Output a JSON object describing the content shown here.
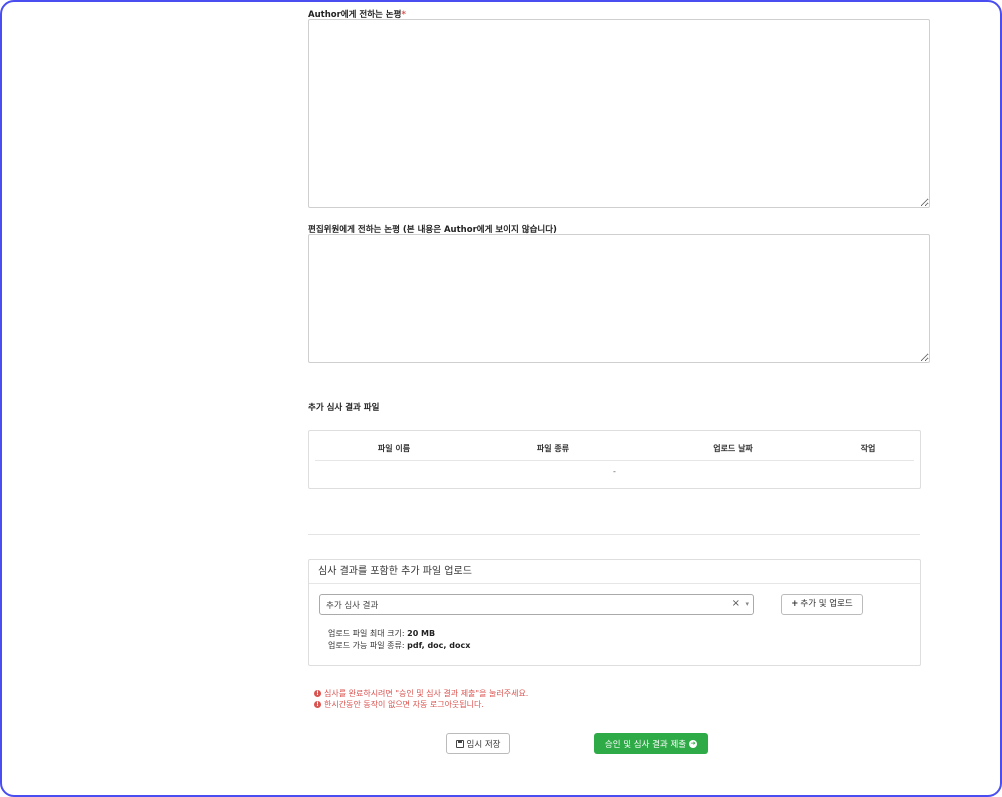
{
  "author_comment": {
    "label": "Author에게 전하는 논평",
    "required_mark": "*",
    "value": ""
  },
  "editor_comment": {
    "label": "편집위원에게 전하는 논평 (본 내용은 Author에게 보이지 않습니다)",
    "value": ""
  },
  "extra_files": {
    "title": "추가 심사 결과 파일",
    "columns": [
      "파일 이름",
      "파일 종류",
      "업로드 날짜",
      "작업"
    ],
    "empty_text": "-"
  },
  "upload_panel": {
    "title": "심사 결과를 포함한 추가 파일 업로드",
    "select": {
      "selected": "추가 심사 결과",
      "clear_glyph": "×",
      "arrow_glyph": "▾"
    },
    "add_button_icon": "plus-icon",
    "add_button_label": "추가 및 업로드",
    "max_size_label": "업로드 파일 최대 크기:",
    "max_size_value": "20 MB",
    "allowed_types_label": "업로드 가능 파일 종류:",
    "allowed_types_value": "pdf, doc, docx"
  },
  "notices": [
    "심사를 완료하시려면 \"승인 및 심사 결과 제출\"을 눌러주세요.",
    "한시간동안 동작이 없으면 자동 로그아웃됩니다."
  ],
  "actions": {
    "save_icon": "floppy-icon",
    "save_label": "임시 저장",
    "submit_label": "승인 및 심사 결과 제출",
    "submit_icon": "arrow-circle-right-icon",
    "submit_color": "#2eaa47"
  },
  "colors": {
    "frame_border": "#4a4ef0",
    "notice": "#d9534f"
  }
}
